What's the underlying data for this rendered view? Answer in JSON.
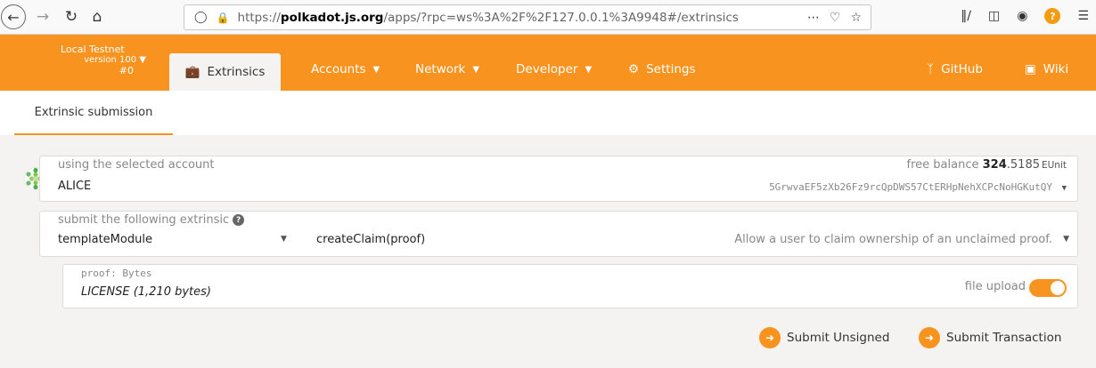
{
  "browser": {
    "url_prefix": "https://",
    "url_domain": "polkadot.js.org",
    "url_rest": "/apps/?rpc=ws%3A%2F%2F127.0.0.1%3A9948#/extrinsics"
  },
  "chain": {
    "name": "Local Testnet",
    "version": "version 100",
    "block": "#0"
  },
  "nav": {
    "extrinsics": "Extrinsics",
    "accounts": "Accounts",
    "network": "Network",
    "developer": "Developer",
    "settings": "Settings",
    "github": "GitHub",
    "wiki": "Wiki"
  },
  "subtab": "Extrinsic submission",
  "account": {
    "label": "using the selected account",
    "name": "ALICE",
    "balance_label": "free balance",
    "balance_int": "324",
    "balance_dec": ".5185",
    "balance_unit": "EUnit",
    "address": "5GrwvaEF5zXb26Fz9rcQpDWS57CtERHpNehXCPcNoHGKutQY"
  },
  "extrinsic": {
    "label": "submit the following extrinsic",
    "module": "templateModule",
    "method": "createClaim(proof)",
    "description": "Allow a user to claim ownership of an unclaimed proof."
  },
  "param": {
    "label": "proof: Bytes",
    "value": "LICENSE (1,210 bytes)",
    "upload_label": "file upload",
    "upload_enabled": true
  },
  "buttons": {
    "unsigned": "Submit Unsigned",
    "transaction": "Submit Transaction"
  },
  "colors": {
    "accent": "#f7931e"
  }
}
